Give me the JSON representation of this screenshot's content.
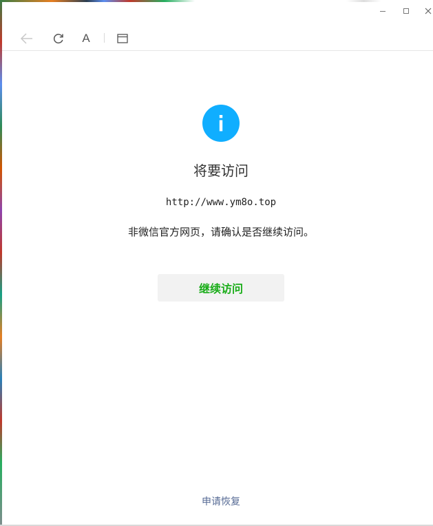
{
  "window_controls": {
    "minimize": "minimize",
    "maximize": "maximize",
    "close": "×"
  },
  "toolbar": {
    "font_label": "A"
  },
  "main": {
    "heading": "将要访问",
    "url": "http://www.ym8o.top",
    "warning": "非微信官方网页，请确认是否继续访问。",
    "continue_label": "继续访问",
    "restore_label": "申请恢复"
  },
  "colors": {
    "info_icon": "#10aeff",
    "continue_text": "#1aad19",
    "link": "#576b95"
  }
}
